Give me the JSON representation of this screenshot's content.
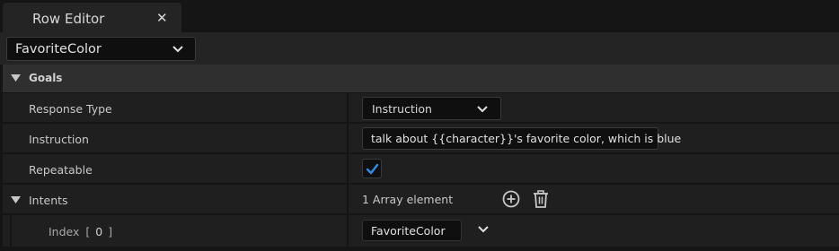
{
  "tab": {
    "title": "Row Editor",
    "close_glyph": "✕"
  },
  "row_selector": {
    "value": "FavoriteColor",
    "icon": "chevron-down-icon"
  },
  "section": {
    "label": "Goals",
    "expanded": true
  },
  "properties": {
    "response_type": {
      "label": "Response Type",
      "value": "Instruction"
    },
    "instruction": {
      "label": "Instruction",
      "value": "talk about {{character}}'s favorite color, which is blue"
    },
    "repeatable": {
      "label": "Repeatable",
      "checked": true
    },
    "intents": {
      "label": "Intents",
      "summary": "1 Array element",
      "expanded": true,
      "add_icon": "add-circle-icon",
      "delete_icon": "trash-icon",
      "elements": [
        {
          "index_label": "Index",
          "index_bracket_open": "[",
          "index_number": "0",
          "index_bracket_close": "]",
          "value": "FavoriteColor"
        }
      ]
    }
  },
  "colors": {
    "accent_check": "#2f8fe8",
    "background": "#151515",
    "panel": "#242424",
    "row": "#1f1f1f",
    "section_header": "#2f2f2f",
    "field": "#0f0f0f"
  }
}
